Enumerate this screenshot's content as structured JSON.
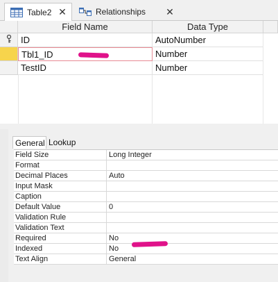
{
  "tabs": [
    {
      "label": "Table2",
      "icon": "table-icon",
      "active": true
    },
    {
      "label": "Relationships",
      "icon": "relationships-icon",
      "active": false
    }
  ],
  "grid": {
    "headers": {
      "field_name": "Field Name",
      "data_type": "Data Type"
    },
    "rows": [
      {
        "field_name": "ID",
        "data_type": "AutoNumber",
        "primary_key": true
      },
      {
        "field_name": "Tbl1_ID",
        "data_type": "Number",
        "selected": true
      },
      {
        "field_name": "TestID",
        "data_type": "Number"
      }
    ]
  },
  "properties": {
    "tabs": [
      "General",
      "Lookup"
    ],
    "rows": [
      {
        "label": "Field Size",
        "value": "Long Integer"
      },
      {
        "label": "Format",
        "value": ""
      },
      {
        "label": "Decimal Places",
        "value": "Auto"
      },
      {
        "label": "Input Mask",
        "value": ""
      },
      {
        "label": "Caption",
        "value": ""
      },
      {
        "label": "Default Value",
        "value": "0"
      },
      {
        "label": "Validation Rule",
        "value": ""
      },
      {
        "label": "Validation Text",
        "value": ""
      },
      {
        "label": "Required",
        "value": "No"
      },
      {
        "label": "Indexed",
        "value": "No"
      },
      {
        "label": "Text Align",
        "value": "General"
      }
    ]
  },
  "colors": {
    "redaction": "#e0128a",
    "active_row_selector": "#f7d44c"
  }
}
